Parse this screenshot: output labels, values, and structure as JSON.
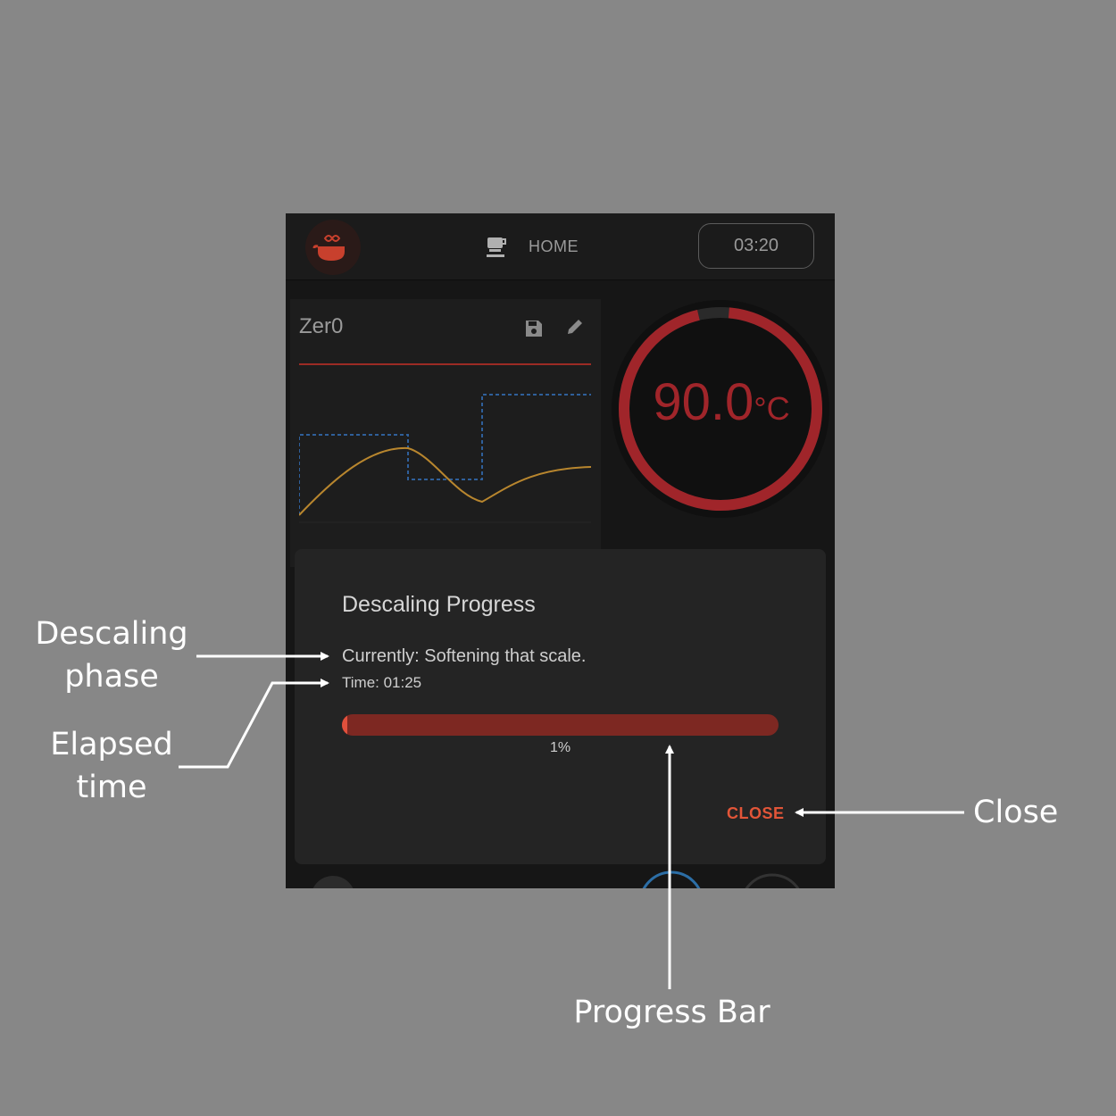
{
  "header": {
    "nav_label": "HOME",
    "clock": "03:20"
  },
  "profile": {
    "name": "Zer0"
  },
  "gauge": {
    "temperature": "90.0",
    "unit": "°C",
    "accent_color": "#a0252a"
  },
  "dialog": {
    "title": "Descaling Progress",
    "phase_text": "Currently: Softening that scale.",
    "time_text": "Time: 01:25",
    "progress_percent": 1,
    "progress_label": "1%",
    "close_label": "CLOSE",
    "accent_color": "#e25538"
  },
  "annotations": {
    "phase": "Descaling phase",
    "time": "Elapsed time",
    "close": "Close",
    "progress_bar": "Progress Bar"
  }
}
